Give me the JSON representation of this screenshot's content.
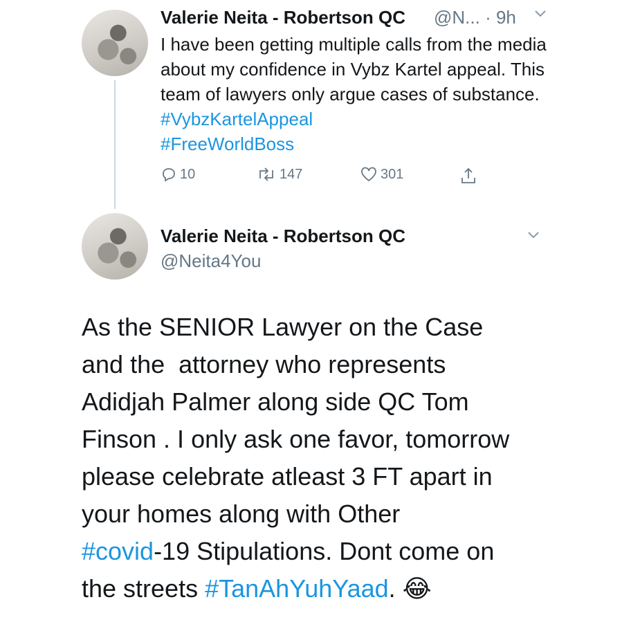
{
  "tweet1": {
    "name": "Valerie Neita - Robertson QC",
    "handle_time": "@N... · 9h",
    "text_a": "I have been getting multiple calls from the media about my confidence in Vybz Kartel appeal. This team of lawyers only argue cases of substance. ",
    "tag1": "#VybzKartelAppeal",
    "tag2": "#FreeWorldBoss",
    "replies": "10",
    "retweets": "147",
    "likes": "301"
  },
  "tweet2": {
    "name": "Valerie Neita - Robertson QC",
    "handle": "@Neita4You",
    "line1": "As the SENIOR Lawyer on the Case",
    "line2": "and the  attorney who represents",
    "line3": "Adidjah Palmer along side QC Tom",
    "line4": "Finson . I only ask one favor, tomorrow",
    "line5": "please celebrate atleast 3 FT apart in",
    "line6": "your homes along with Other",
    "tag_covid": "#covid",
    "line7_rest": "-19 Stipulations. Dont come on",
    "line8_a": "the streets ",
    "tag_tan": "#TanAhYuhYaad",
    "line8_b": ". 😂"
  },
  "colors": {
    "hashtag": "#1b95e0",
    "muted": "#657786",
    "text": "#14171a"
  },
  "icons": [
    "reply-icon",
    "retweet-icon",
    "like-icon",
    "share-icon",
    "chevron-down-icon"
  ]
}
